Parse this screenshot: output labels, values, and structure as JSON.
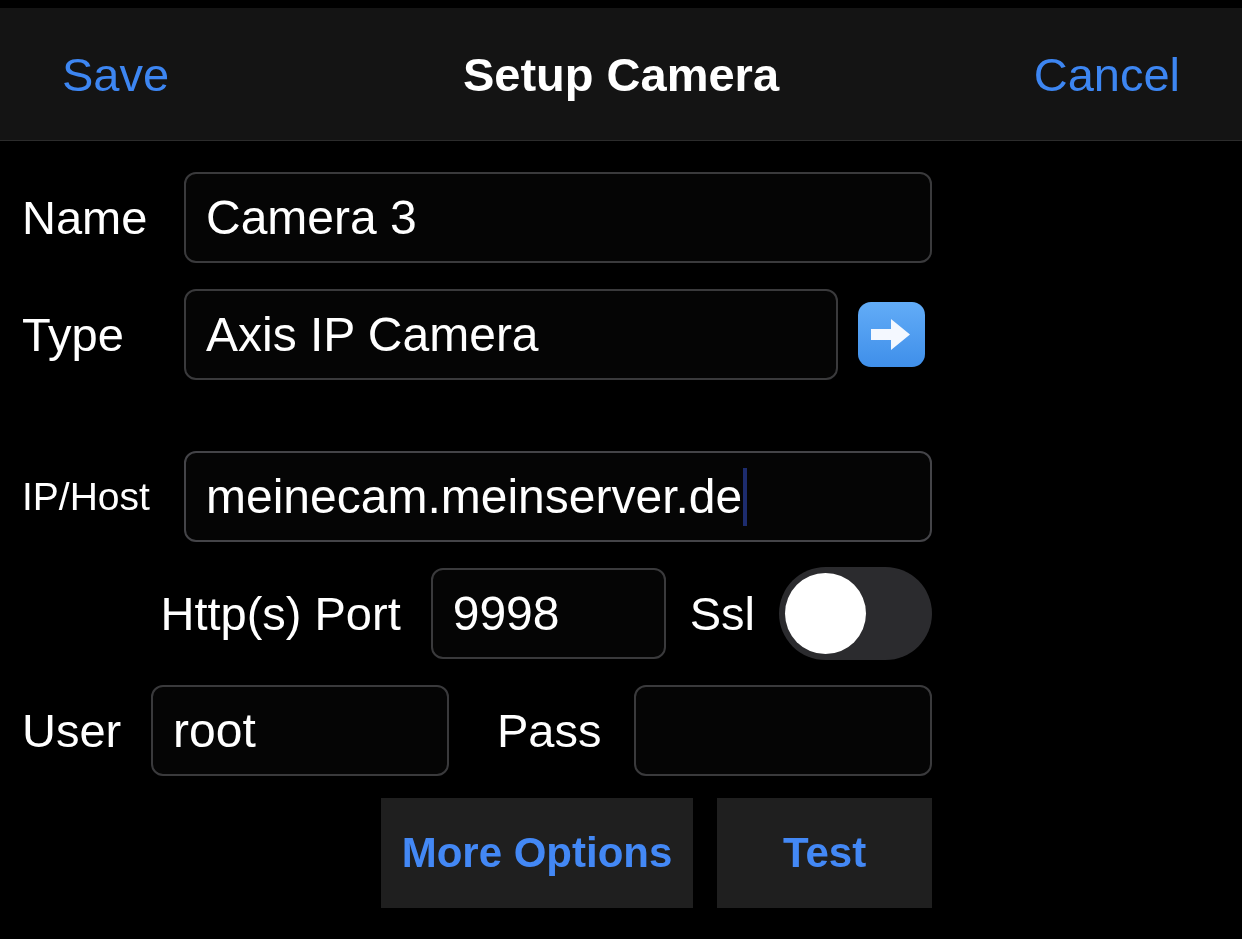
{
  "nav_bar": {
    "left_button": "Save",
    "title": "Setup Camera",
    "right_button": "Cancel"
  },
  "form": {
    "name": {
      "label": "Name",
      "value": "Camera 3",
      "focused": false
    },
    "type": {
      "label": "Type",
      "value": "Axis IP Camera",
      "focused": false
    },
    "ip_host": {
      "label": "IP/Host",
      "value": "meinecam.meinserver.de",
      "focused": true
    },
    "port": {
      "label": "Http(s) Port",
      "value": "9998",
      "focused": false
    },
    "ssl": {
      "label": "Ssl",
      "on": false
    },
    "user": {
      "label": "User",
      "value": "root",
      "focused": false
    },
    "pass": {
      "label": "Pass",
      "focused": false
    }
  },
  "buttons": [
    {
      "label": "More Options"
    },
    {
      "label": "Test"
    }
  ]
}
